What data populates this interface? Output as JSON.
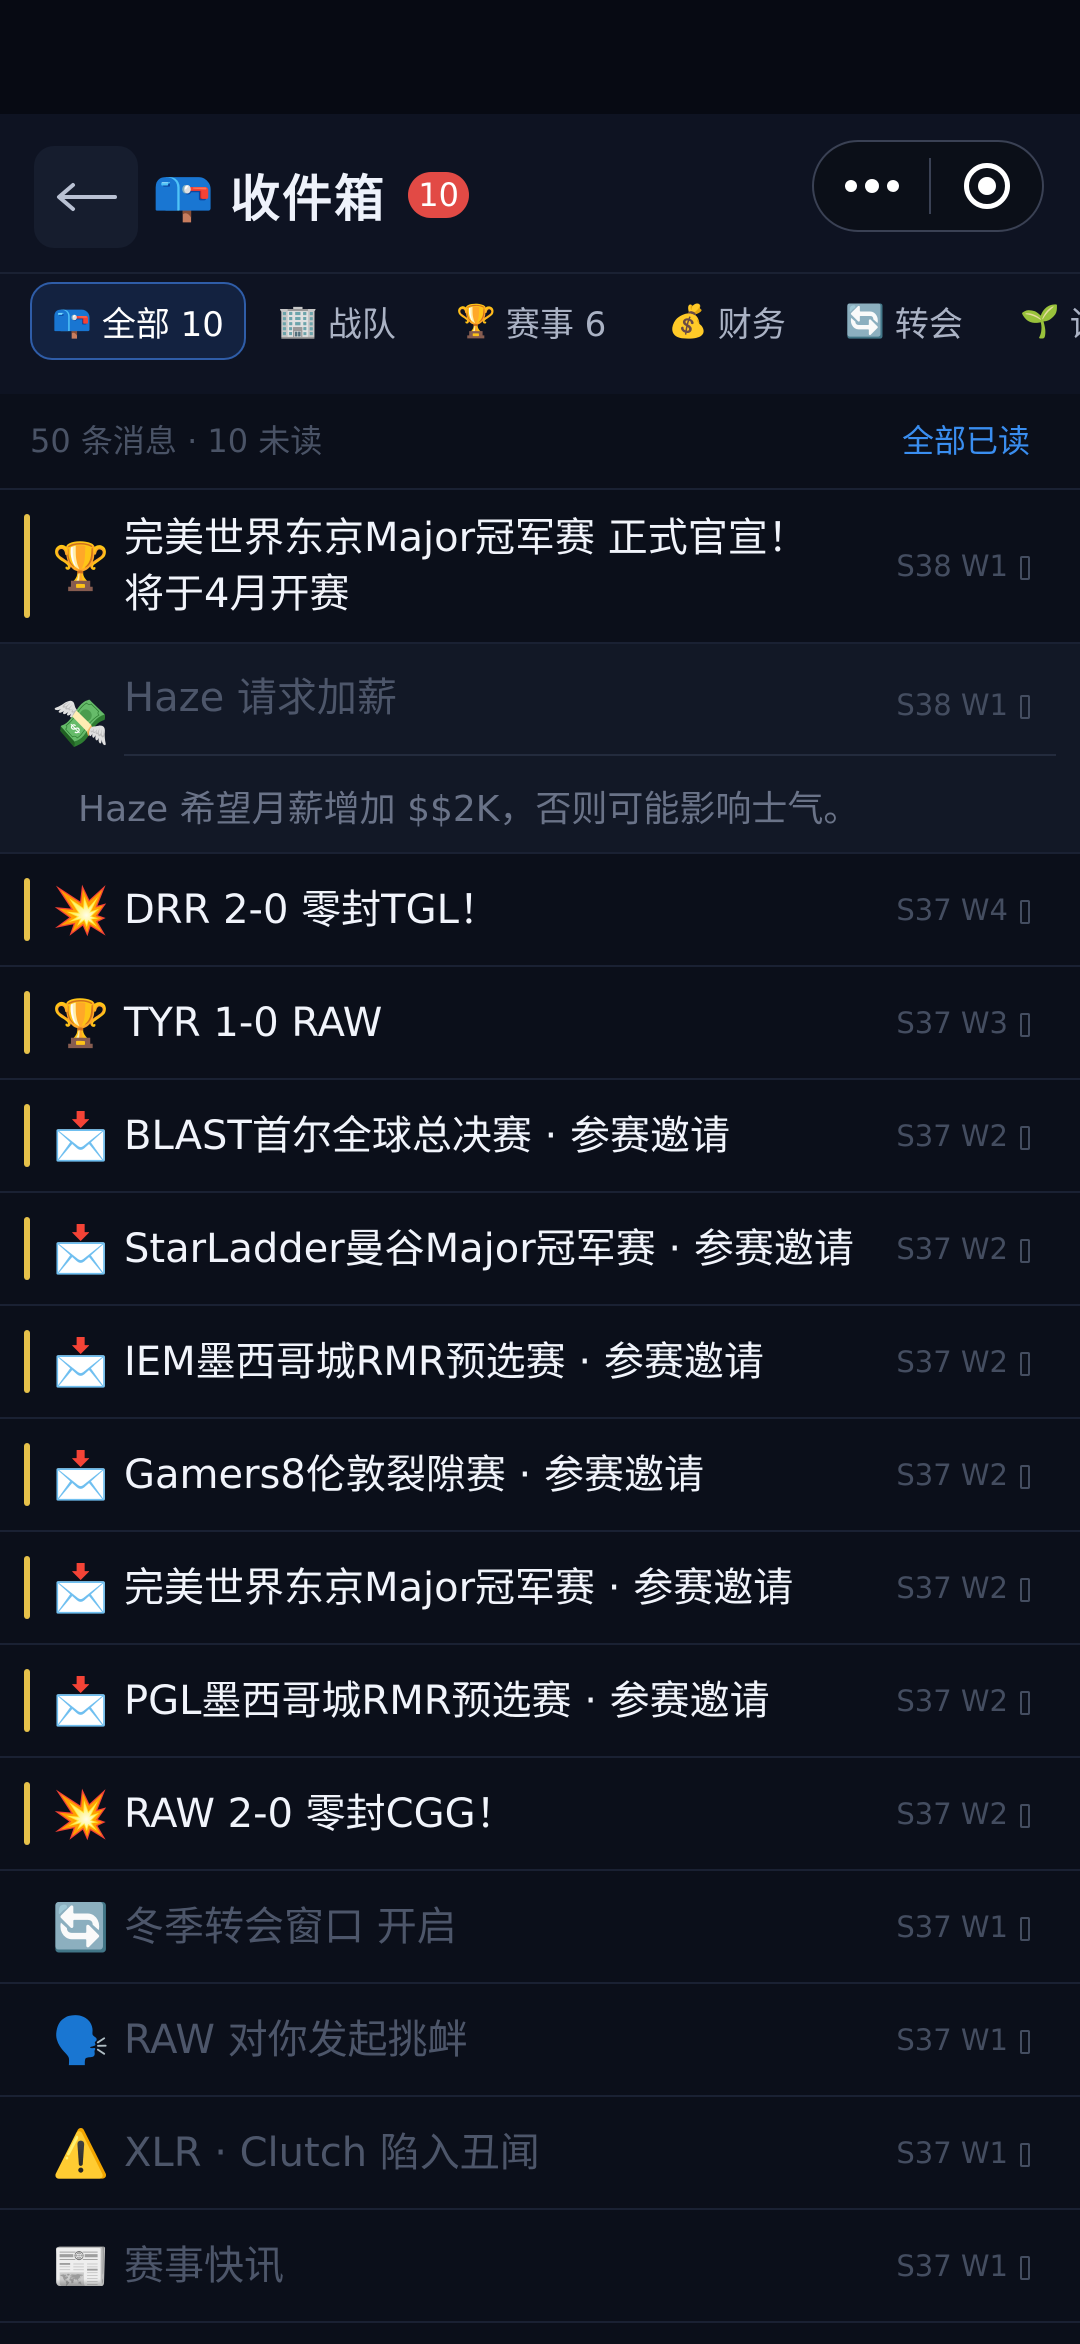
{
  "header": {
    "title_icon": "📪",
    "title": "收件箱",
    "badge": "10",
    "back_icon": "arrow-left-icon"
  },
  "tabs": [
    {
      "icon": "📪",
      "label": "全部 10",
      "active": true
    },
    {
      "icon": "🏢",
      "label": "战队"
    },
    {
      "icon": "🏆",
      "label": "赛事 6"
    },
    {
      "icon": "💰",
      "label": "财务"
    },
    {
      "icon": "🔄",
      "label": "转会"
    },
    {
      "icon": "🌱",
      "label": "训"
    }
  ],
  "summary": {
    "info": "50 条消息 · 10 未读",
    "read_all": "全部已读"
  },
  "messages": [
    {
      "icon": "🏆",
      "title": "完美世界东京Major冠军赛 正式官宣！将于4月开赛",
      "time": "S38 W1",
      "unread": true
    },
    {
      "icon": "💸",
      "title": "Haze 请求加薪",
      "time": "S38 W1",
      "unread": false,
      "detail": "Haze 希望月薪增加 $$2K，否则可能影响士气。"
    },
    {
      "icon": "💥",
      "title": "DRR 2-0 零封TGL！",
      "time": "S37 W4",
      "unread": true
    },
    {
      "icon": "🏆",
      "title": "TYR 1-0 RAW",
      "time": "S37 W3",
      "unread": true
    },
    {
      "icon": "📩",
      "title": "BLAST首尔全球总决赛 · 参赛邀请",
      "time": "S37 W2",
      "unread": true
    },
    {
      "icon": "📩",
      "title": "StarLadder曼谷Major冠军赛 · 参赛邀请",
      "time": "S37 W2",
      "unread": true
    },
    {
      "icon": "📩",
      "title": "IEM墨西哥城RMR预选赛 · 参赛邀请",
      "time": "S37 W2",
      "unread": true
    },
    {
      "icon": "📩",
      "title": "Gamers8伦敦裂隙赛 · 参赛邀请",
      "time": "S37 W2",
      "unread": true
    },
    {
      "icon": "📩",
      "title": "完美世界东京Major冠军赛 · 参赛邀请",
      "time": "S37 W2",
      "unread": true
    },
    {
      "icon": "📩",
      "title": "PGL墨西哥城RMR预选赛 · 参赛邀请",
      "time": "S37 W2",
      "unread": true
    },
    {
      "icon": "💥",
      "title": "RAW 2-0 零封CGG！",
      "time": "S37 W2",
      "unread": true
    },
    {
      "icon": "🔄",
      "title": "冬季转会窗口 开启",
      "time": "S37 W1",
      "unread": false
    },
    {
      "icon": "🗣️",
      "title": "RAW 对你发起挑衅",
      "time": "S37 W1",
      "unread": false
    },
    {
      "icon": "⚠️",
      "title": "XLR · Clutch 陷入丑闻",
      "time": "S37 W1",
      "unread": false
    },
    {
      "icon": "📰",
      "title": "赛事快讯",
      "time": "S37 W1",
      "unread": false
    }
  ],
  "colors": {
    "background": "#0b0f1a",
    "accent": "#3a8ef0",
    "badge": "#e24a45",
    "unread_bar": "#e6c14a"
  }
}
